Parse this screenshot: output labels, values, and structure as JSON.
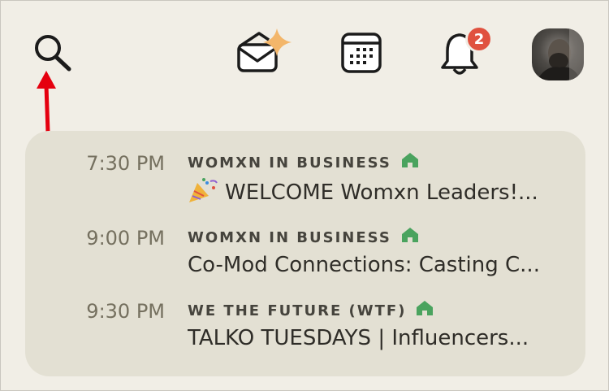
{
  "header": {
    "notification_count": "2",
    "icons": [
      "search-icon",
      "explore-icon",
      "calendar-icon",
      "bell-icon",
      "avatar"
    ]
  },
  "colors": {
    "background": "#f1eee6",
    "card": "#e3e0d3",
    "badge": "#e0513f",
    "house_icon": "#4aa35e",
    "sparkle": "#f3b66a",
    "annotation_arrow": "#e5000f"
  },
  "events": [
    {
      "time": "7:30 PM",
      "club": "WOMXN IN BUSINESS",
      "title": "WELCOME Womxn Leaders!...",
      "has_emoji": true
    },
    {
      "time": "9:00 PM",
      "club": "WOMXN IN BUSINESS",
      "title": "Co-Mod Connections: Casting C..."
    },
    {
      "time": "9:30 PM",
      "club": "WE THE FUTURE (WTF)",
      "title": "TALKO TUESDAYS | Influencers..."
    }
  ]
}
